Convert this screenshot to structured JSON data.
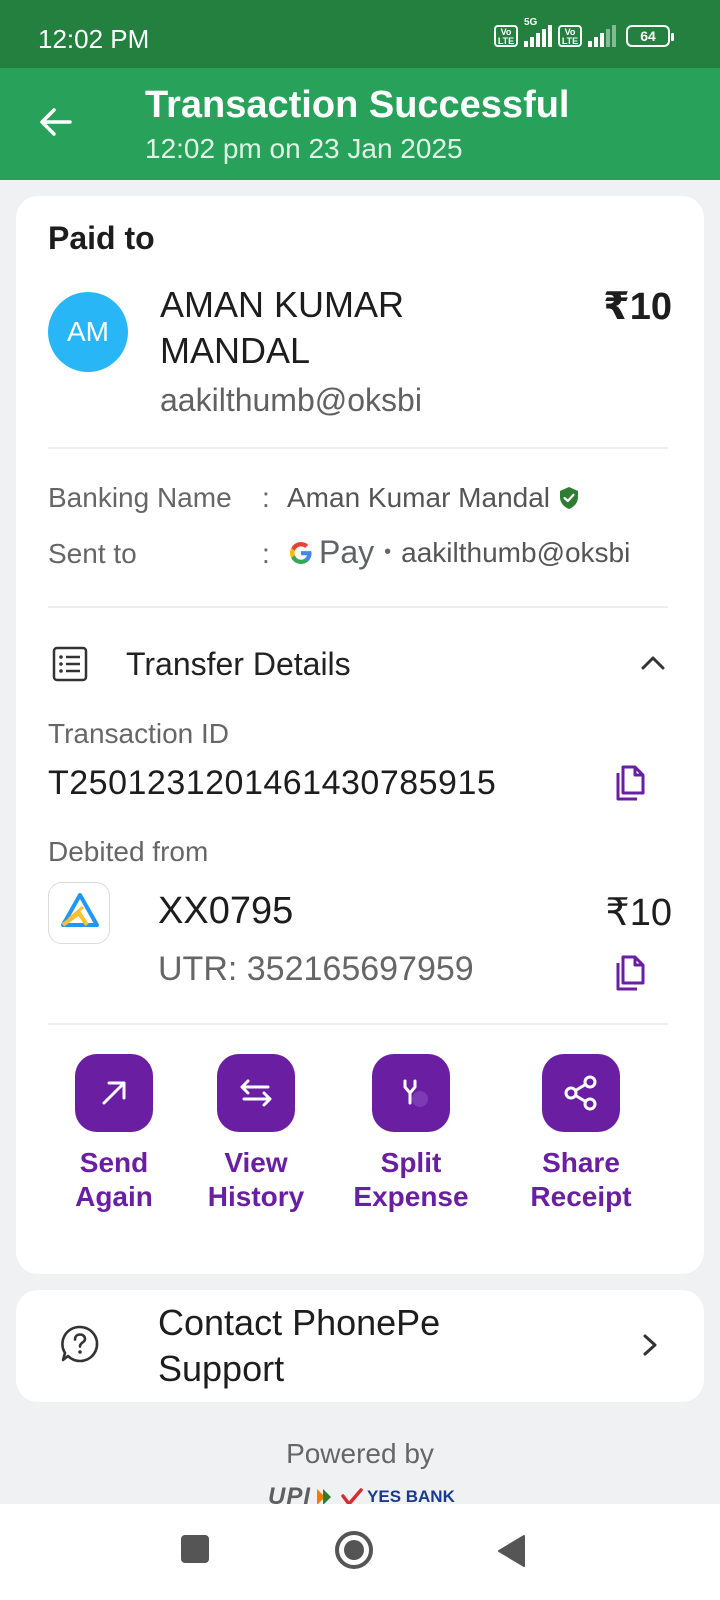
{
  "status_bar": {
    "time": "12:02 PM",
    "network_type": "5G",
    "volte_label": "Vo LTE",
    "battery": "64"
  },
  "header": {
    "title": "Transaction Successful",
    "subtitle": "12:02 pm on 23 Jan 2025",
    "back_icon": "arrow-left-icon",
    "background": "#28a15a"
  },
  "payee": {
    "section_label": "Paid to",
    "initials": "AM",
    "name": "AMAN KUMAR MANDAL",
    "amount": "₹10",
    "vpa": "aakilthumb@oksbi",
    "avatar_color": "#29b6f6"
  },
  "details": {
    "banking_name_label": "Banking Name",
    "banking_name_value": "Aman Kumar Mandal",
    "sent_to_label": "Sent to",
    "sent_to_app": "Pay",
    "sent_to_vpa": "aakilthumb@oksbi",
    "colon": ":",
    "separator": "•"
  },
  "transfer": {
    "title": "Transfer Details",
    "transaction_id_label": "Transaction ID",
    "transaction_id": "T2501231201461430785915",
    "debited_from_label": "Debited from",
    "account": "XX0795",
    "account_amount": "₹10",
    "utr": "UTR: 352165697959"
  },
  "actions": [
    {
      "label": "Send\nAgain",
      "icon": "arrow-up-right-icon"
    },
    {
      "label": "View\nHistory",
      "icon": "arrows-swap-icon"
    },
    {
      "label": "Split\nExpense",
      "icon": "split-icon"
    },
    {
      "label": "Share\nReceipt",
      "icon": "share-icon"
    }
  ],
  "support": {
    "label": "Contact PhonePe Support"
  },
  "footer": {
    "powered_by": "Powered by",
    "upi": "UPI",
    "bank": "YES BANK"
  },
  "colors": {
    "accent": "#6a1fa3",
    "status_bar": "#24803f",
    "verified": "#2e7d32"
  }
}
